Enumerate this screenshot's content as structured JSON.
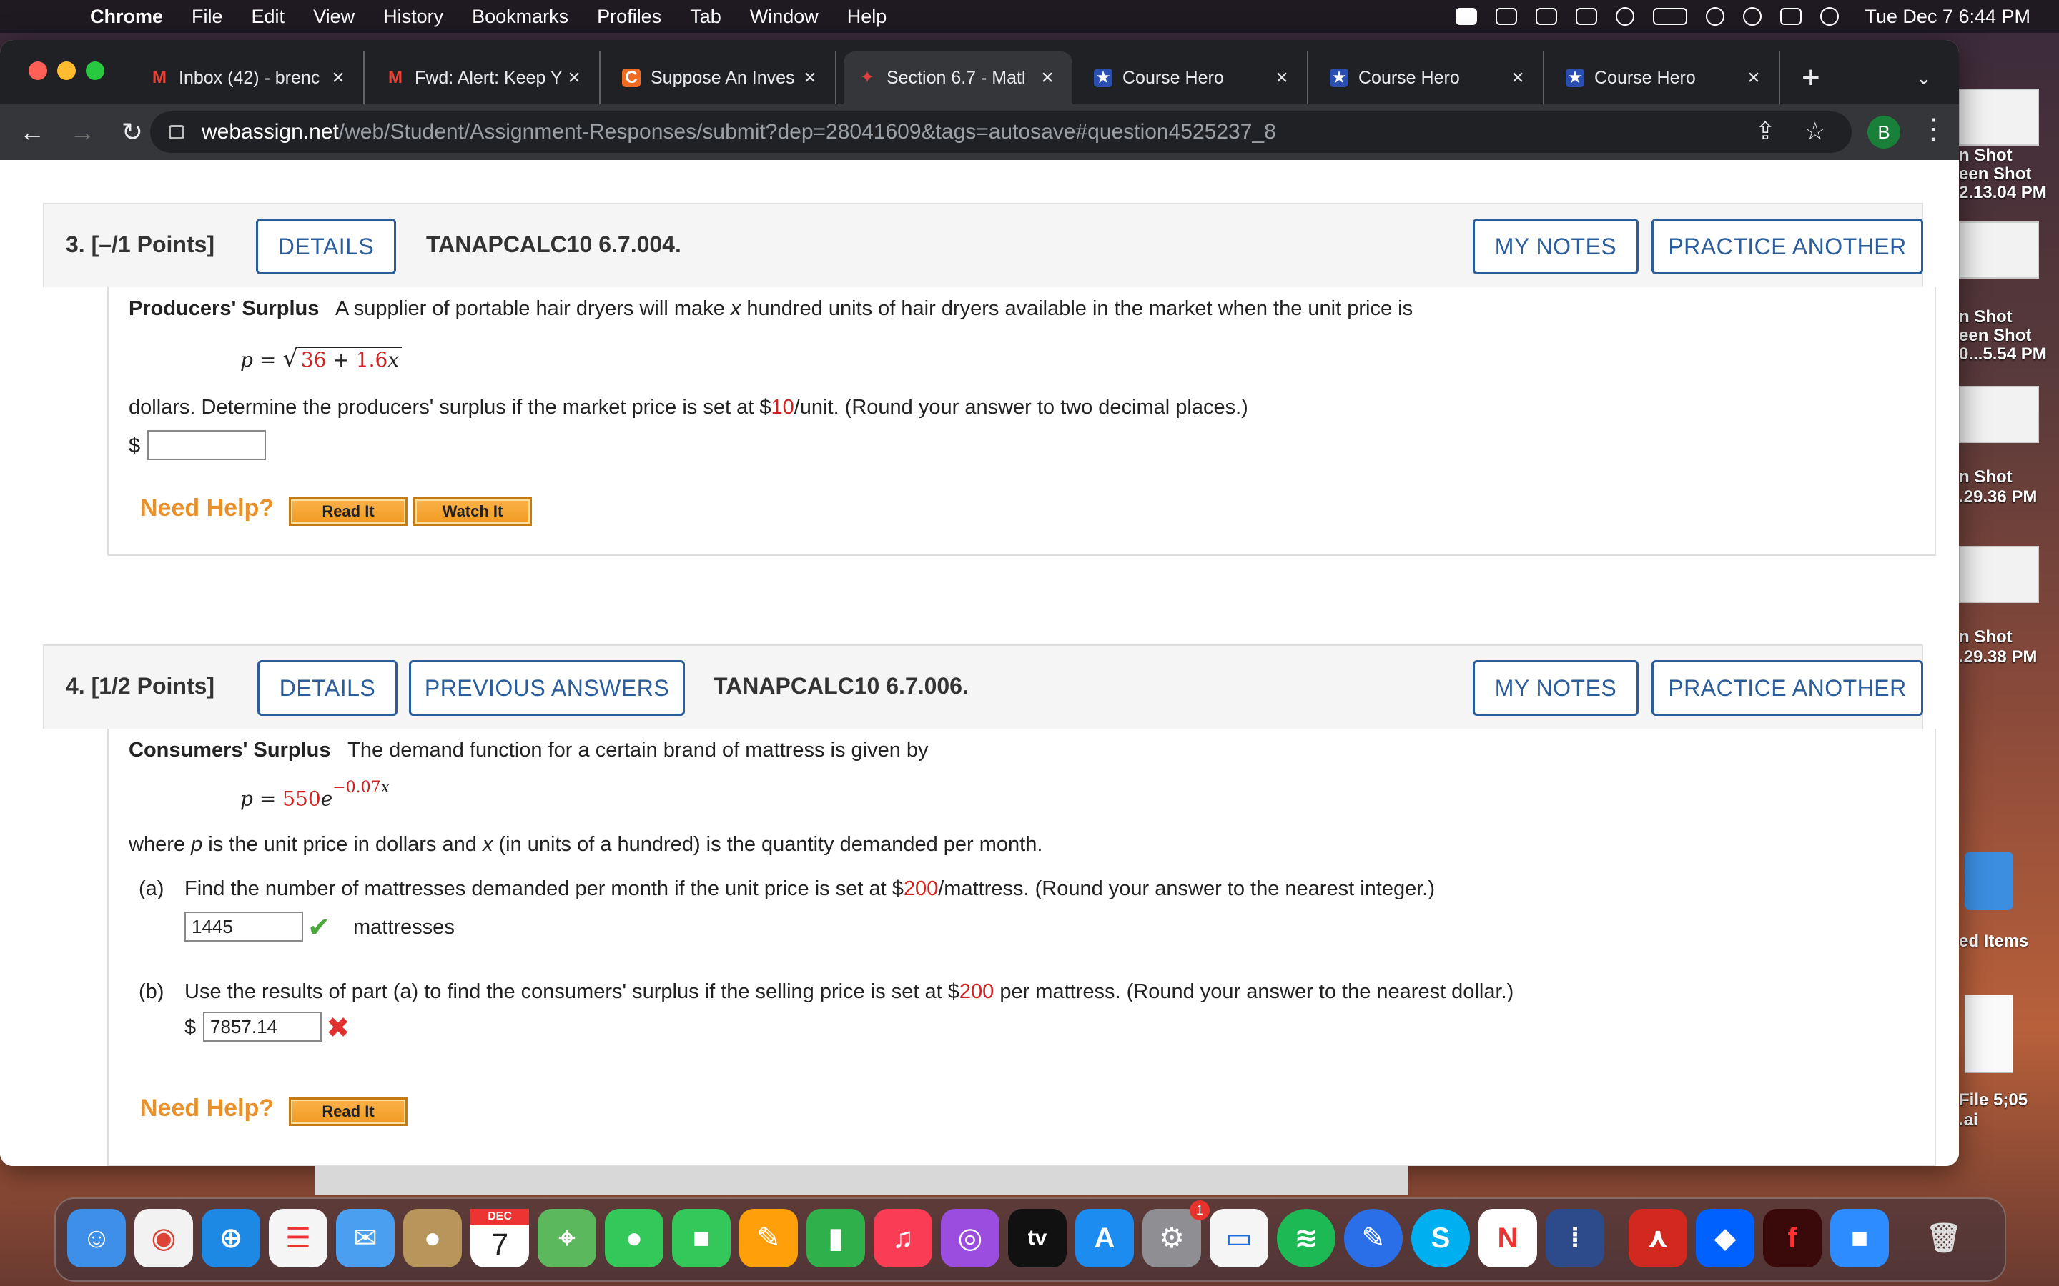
{
  "menubar": {
    "app": "Chrome",
    "items": [
      "File",
      "Edit",
      "View",
      "History",
      "Bookmarks",
      "Profiles",
      "Tab",
      "Window",
      "Help"
    ],
    "clock": "Tue Dec 7  6:44 PM"
  },
  "tabs": [
    {
      "title": "Inbox (42) - brenc",
      "favicon": "gmail-icon",
      "fav_glyph": "M",
      "color": "#ea4335"
    },
    {
      "title": "Fwd: Alert: Keep Y",
      "favicon": "gmail-icon",
      "fav_glyph": "M",
      "color": "#ea4335"
    },
    {
      "title": "Suppose An Inves",
      "favicon": "chegg-icon",
      "fav_glyph": "C",
      "color": "#f06b22"
    },
    {
      "title": "Section 6.7 - Matl",
      "favicon": "webassign-icon",
      "fav_glyph": "✦",
      "color": "#d33"
    },
    {
      "title": "Course Hero",
      "favicon": "coursehero-icon",
      "fav_glyph": "★",
      "color": "#2a4fb0"
    },
    {
      "title": "Course Hero",
      "favicon": "coursehero-icon",
      "fav_glyph": "★",
      "color": "#2a4fb0"
    },
    {
      "title": "Course Hero",
      "favicon": "coursehero-icon",
      "fav_glyph": "★",
      "color": "#2a4fb0"
    }
  ],
  "address": {
    "host": "webassign.net",
    "path": "/web/Student/Assignment-Responses/submit?dep=28041609&tags=autosave#question4525237_8"
  },
  "profile_initial": "B",
  "q3": {
    "num": "3.",
    "points": "[–/1 Points]",
    "details": "DETAILS",
    "code": "TANAPCALC10 6.7.004.",
    "my_notes": "MY NOTES",
    "practice": "PRACTICE ANOTHER",
    "heading": "Producers' Surplus",
    "intro": "A supplier of portable hair dryers will make",
    "intro_var": "x",
    "intro_rest": "hundred units of hair dryers available in the market when the unit price is",
    "eq_lhs": "p",
    "eq_eq": "=",
    "eq_a": "36",
    "eq_plus": "+",
    "eq_b": "1.6",
    "eq_var": "x",
    "body_pre": "dollars. Determine the producers' surplus if the market price is set at $",
    "body_price": "10",
    "body_post": "/unit. (Round your answer to two decimal places.)",
    "dollar": "$",
    "answer": "",
    "need_help": "Need Help?",
    "read_it": "Read It",
    "watch_it": "Watch It"
  },
  "q4": {
    "num": "4.",
    "points": "[1/2 Points]",
    "details": "DETAILS",
    "previous": "PREVIOUS ANSWERS",
    "code": "TANAPCALC10 6.7.006.",
    "my_notes": "MY NOTES",
    "practice": "PRACTICE ANOTHER",
    "heading": "Consumers' Surplus",
    "intro": "The demand function for a certain brand of mattress is given by",
    "eq_lhs": "p",
    "eq_eq": "=",
    "eq_coef": "550",
    "eq_e": "e",
    "eq_exp": "−0.07",
    "eq_exp_var": "x",
    "where_1": "where",
    "where_p": "p",
    "where_2": "is the unit price in dollars and",
    "where_x": "x",
    "where_3": "(in units of a hundred) is the quantity demanded per month.",
    "a_label": "(a)",
    "a_pre": "Find the number of mattresses demanded per month if the unit price is set at $",
    "a_price": "200",
    "a_post": "/mattress. (Round your answer to the nearest integer.)",
    "a_answer": "1445",
    "a_unit": "mattresses",
    "b_label": "(b)",
    "b_pre": "Use the results of part (a) to find the consumers' surplus if the selling price is set at $",
    "b_price": "200",
    "b_post": "per mattress. (Round your answer to the nearest dollar.)",
    "dollar": "$",
    "b_answer": "7857.14",
    "need_help": "Need Help?",
    "read_it": "Read It"
  },
  "desktop": [
    "n Shot",
    "een Shot",
    "2.13.04 PM",
    "n Shot",
    "een Shot",
    "0...5.54 PM",
    "n Shot",
    ".29.36 PM",
    "n Shot",
    ".29.38 PM",
    "ed Items",
    "File 5;05",
    ".ai"
  ],
  "dock": {
    "calendar_month": "DEC",
    "calendar_day": "7",
    "tv_label": "tv",
    "settings_badge": "1"
  }
}
